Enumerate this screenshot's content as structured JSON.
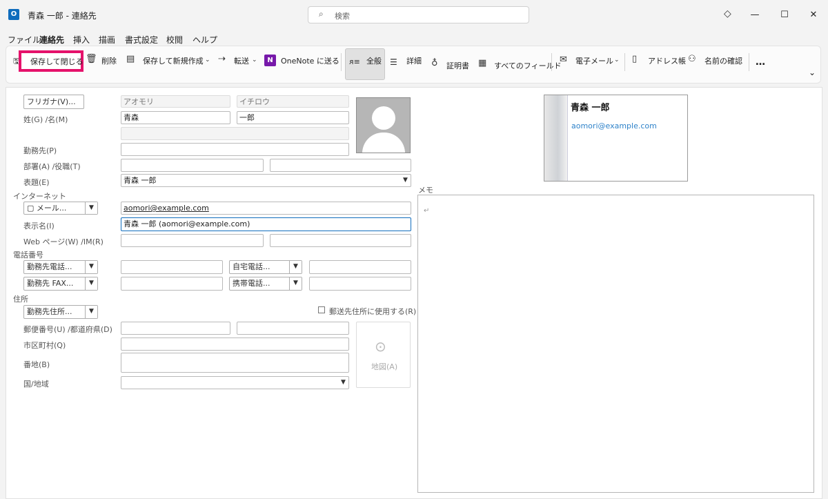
{
  "window": {
    "title": "青森 一郎  -  連絡先",
    "search_placeholder": "検索",
    "app_icon_letter": "O",
    "controls": {
      "minimize": "—",
      "maximize": "☐",
      "close": "✕"
    }
  },
  "menu": [
    "ファイル",
    "連絡先",
    "挿入",
    "描画",
    "書式設定",
    "校閲",
    "ヘルプ"
  ],
  "ribbon": {
    "save_close": "保存して閉じる",
    "delete": "削除",
    "save_new": "保存して新規作成",
    "forward": "転送",
    "onenote": "OneNote に送る",
    "general": "全般",
    "details": "詳細",
    "certificates": "証明書",
    "all_fields": "すべてのフィールド",
    "email": "電子メール",
    "address_book": "アドレス帳",
    "check_names": "名前の確認",
    "more": "…",
    "collapse": "⌄"
  },
  "form": {
    "furigana_button": "フリガナ(V)...",
    "furigana_last": "アオモリ",
    "furigana_first": "イチロウ",
    "name_label": "姓(G)  /名(M)",
    "last_name": "青森",
    "first_name": "一郎",
    "company_label": "勤務先(P)",
    "company": "",
    "dept_label": "部署(A)  /役職(T)",
    "file_as_label": "表題(E)",
    "file_as": "青森 一郎",
    "internet_section": "インターネット",
    "email_button": "メール...",
    "email": "aomori@example.com",
    "display_name_label": "表示名(I)",
    "display_name": "青森 一郎 (aomori@example.com)",
    "web_label": "Web ページ(W)  /IM(R)",
    "phone_section": "電話番号",
    "phone_business": "勤務先電話...",
    "phone_home": "自宅電話...",
    "phone_fax": "勤務先 FAX...",
    "phone_mobile": "携帯電話...",
    "address_section": "住所",
    "address_type": "勤務先住所...",
    "postal_checkbox": "郵送先住所に使用する(R)",
    "zip_label": "郵便番号(U)  /都道府県(D)",
    "city_label": "市区町村(Q)",
    "street_label": "番地(B)",
    "country_label": "国/地域",
    "map_button": "地図(A)"
  },
  "card": {
    "name": "青森 一郎",
    "email": "aomori@example.com"
  },
  "memo": {
    "label": "メモ",
    "mark": "↵"
  },
  "colors": {
    "accent": "#0f6cbd",
    "highlight": "#e5126b"
  }
}
